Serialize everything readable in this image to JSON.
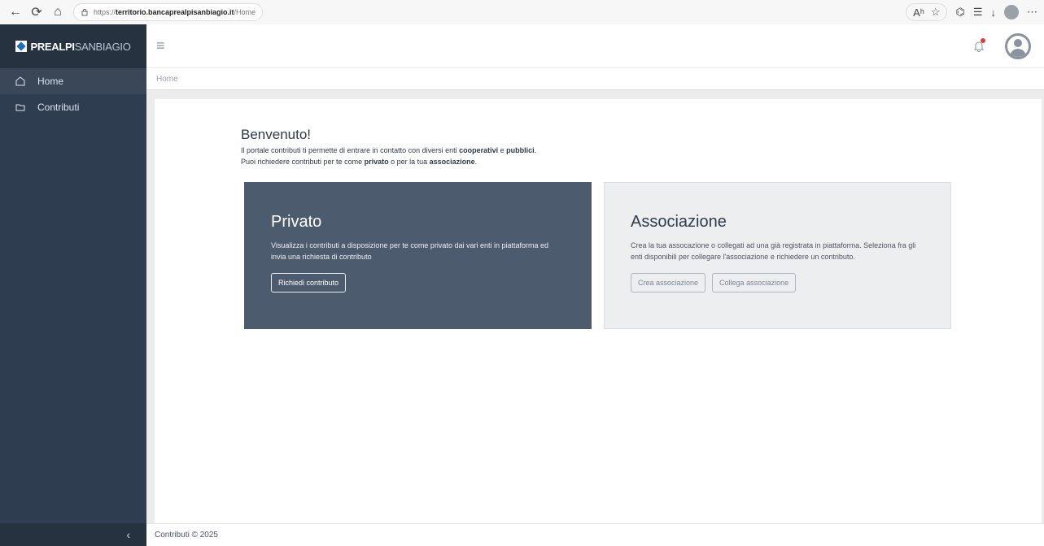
{
  "browser": {
    "url_protocol": "https://",
    "url_host": "territorio.bancaprealpisanbiagio.it",
    "url_path": "/Home"
  },
  "sidebar": {
    "logo_main": "PREALPI",
    "logo_second": "SANBIAGIO",
    "items": [
      {
        "label": "Home"
      },
      {
        "label": "Contributi"
      }
    ],
    "collapse_symbol": "‹"
  },
  "topbar": {
    "menu_symbol": "≡"
  },
  "breadcrumb": {
    "label": "Home"
  },
  "welcome": {
    "title": "Benvenuto!",
    "line1_a": "Il portale contributi ti permette di entrare in contatto con diversi enti ",
    "line1_b": "cooperativi",
    "line1_c": " e ",
    "line1_d": "pubblici",
    "line1_e": ".",
    "line2_a": "Puoi richiedere contributi per te come ",
    "line2_b": "privato",
    "line2_c": " o per la tua ",
    "line2_d": "associazione",
    "line2_e": "."
  },
  "private_panel": {
    "title": "Privato",
    "description": "Visualizza i contributi a disposizione per te come privato dai vari enti in piattaforma ed invia una richiesta di contributo",
    "button": "Richiedi contributo"
  },
  "assoc_panel": {
    "title": "Associazione",
    "description": "Crea la tua assocazione o collegati ad una già registrata in piattaforma. Seleziona fra gli enti disponibili per collegare l'associazione e richiedere un contributo.",
    "button_create": "Crea associazione",
    "button_link": "Collega associazione"
  },
  "footer": {
    "text": "Contributi © 2025"
  },
  "colors": {
    "sidebar": "#2f3d50",
    "private_panel": "#4d5b6f",
    "assoc_panel": "#eceef0",
    "notification_dot": "#e23a3a"
  }
}
